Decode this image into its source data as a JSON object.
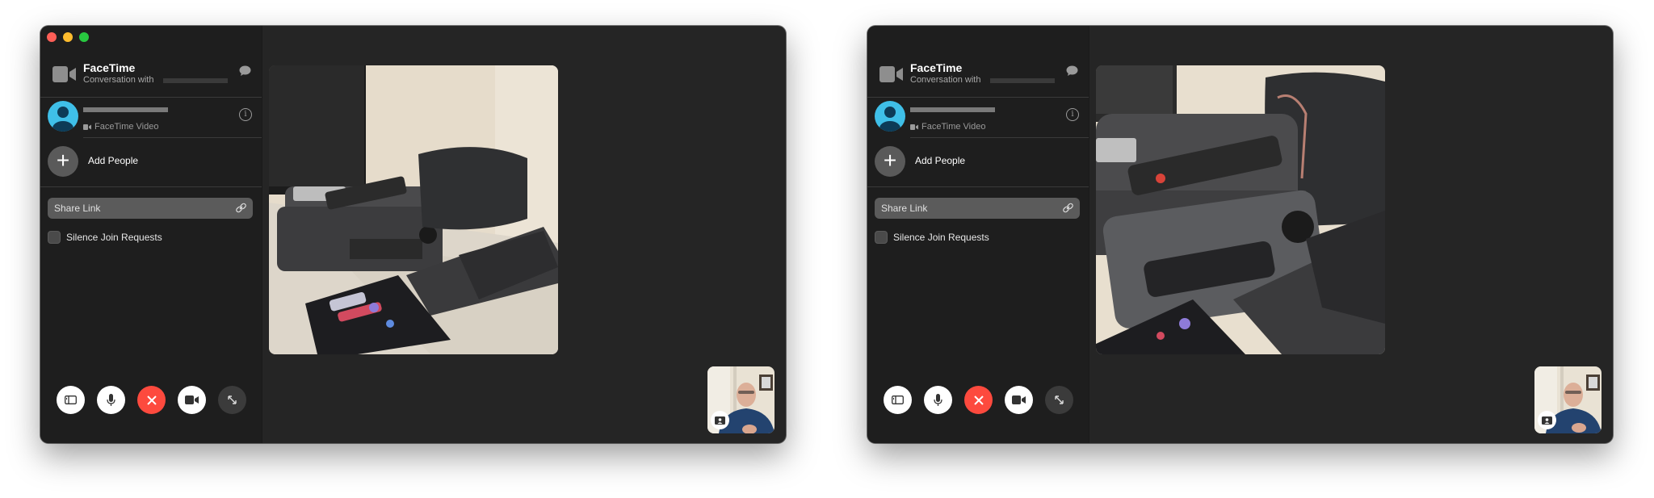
{
  "windows": [
    {
      "id": "window-1",
      "show_traffic_lights": true,
      "header": {
        "title": "FaceTime",
        "subtitle": "Conversation with",
        "icon": "video-camera-icon",
        "message_icon": "message-bubble-icon"
      },
      "contact": {
        "name_redacted": true,
        "call_type": "FaceTime Video",
        "call_type_icon": "video-camera-icon",
        "info_icon": "info-icon",
        "avatar_color": "#3fbfe8"
      },
      "add_people": {
        "label": "Add People",
        "icon": "plus-icon"
      },
      "share_link": {
        "label": "Share Link",
        "icon": "link-icon"
      },
      "silence_join_requests": {
        "label": "Silence Join Requests",
        "checked": false
      },
      "controls": [
        {
          "name": "sidebar-toggle",
          "icon": "sidebar-icon"
        },
        {
          "name": "mute",
          "icon": "microphone-icon"
        },
        {
          "name": "end-call",
          "icon": "close-icon",
          "color": "#fd4a3e"
        },
        {
          "name": "camera",
          "icon": "video-camera-icon"
        },
        {
          "name": "fullscreen",
          "icon": "expand-icon"
        }
      ],
      "remote_video": {
        "description": "Desk with Mac mini, remote, DAC, bag, keyboard and foldable phone",
        "zoom": "wide"
      },
      "self_view": {
        "description": "Self-view of man with glasses in blue shirt",
        "badge_icon": "portrait-mode-icon"
      }
    },
    {
      "id": "window-2",
      "show_traffic_lights": false,
      "header": {
        "title": "FaceTime",
        "subtitle": "Conversation with",
        "icon": "video-camera-icon",
        "message_icon": "message-bubble-icon"
      },
      "contact": {
        "name_redacted": true,
        "call_type": "FaceTime Video",
        "call_type_icon": "video-camera-icon",
        "info_icon": "info-icon",
        "avatar_color": "#3fbfe8"
      },
      "add_people": {
        "label": "Add People",
        "icon": "plus-icon"
      },
      "share_link": {
        "label": "Share Link",
        "icon": "link-icon"
      },
      "silence_join_requests": {
        "label": "Silence Join Requests",
        "checked": false
      },
      "controls": [
        {
          "name": "sidebar-toggle",
          "icon": "sidebar-icon"
        },
        {
          "name": "mute",
          "icon": "microphone-icon"
        },
        {
          "name": "end-call",
          "icon": "close-icon",
          "color": "#fd4a3e"
        },
        {
          "name": "camera",
          "icon": "video-camera-icon"
        },
        {
          "name": "fullscreen",
          "icon": "expand-icon"
        }
      ],
      "remote_video": {
        "description": "Zoomed-in desk view with Mac mini, remote, DAC, bag and keyboard",
        "zoom": "close"
      },
      "self_view": {
        "description": "Self-view of man with glasses in blue shirt",
        "badge_icon": "portrait-mode-icon"
      }
    }
  ]
}
